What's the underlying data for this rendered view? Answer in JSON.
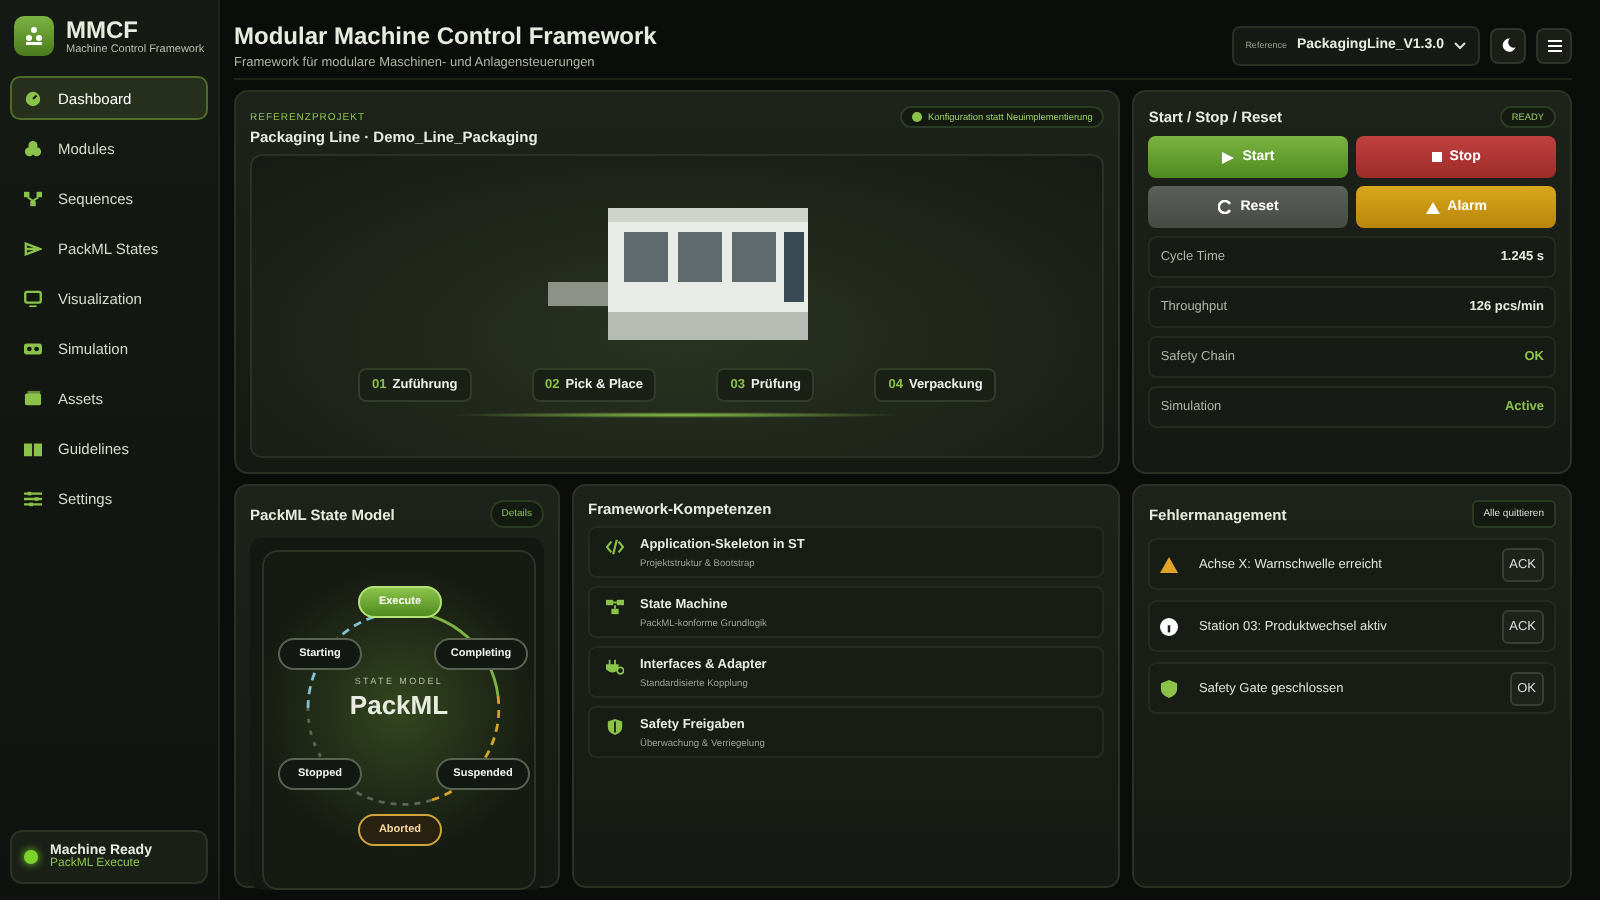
{
  "sidebar": {
    "logo": {
      "title": "MMCF",
      "subtitle": "Machine Control Framework"
    },
    "items": [
      {
        "label": "Dashboard",
        "selected": true
      },
      {
        "label": "Modules",
        "selected": false
      },
      {
        "label": "Sequences",
        "selected": false
      },
      {
        "label": "PackML States",
        "selected": false
      },
      {
        "label": "Visualization",
        "selected": false
      },
      {
        "label": "Simulation",
        "selected": false
      },
      {
        "label": "Assets",
        "selected": false
      },
      {
        "label": "Guidelines",
        "selected": false
      },
      {
        "label": "Settings",
        "selected": false
      }
    ],
    "status": {
      "title": "Machine Ready",
      "subtitle": "PackML Execute"
    }
  },
  "header": {
    "title": "Modular Machine Control Framework",
    "subtitle": "Framework für modulare Maschinen- und Anlagensteuerungen",
    "reference": {
      "label": "Reference",
      "value": "PackagingLine_V1.3.0"
    }
  },
  "project": {
    "eyebrow": "REFERENZPROJEKT",
    "title": "Packaging Line · Demo_Line_Packaging",
    "badge": "Konfiguration statt Neuimplementierung",
    "stations": [
      {
        "number": "01",
        "label": "Zuführung"
      },
      {
        "number": "02",
        "label": "Pick & Place"
      },
      {
        "number": "03",
        "label": "Prüfung"
      },
      {
        "number": "04",
        "label": "Verpackung"
      }
    ]
  },
  "control": {
    "title": "Start / Stop / Reset",
    "badge": "READY",
    "buttons": [
      {
        "kind": "start",
        "label": "Start"
      },
      {
        "kind": "stop",
        "label": "Stop"
      },
      {
        "kind": "reset",
        "label": "Reset"
      },
      {
        "kind": "alarm",
        "label": "Alarm"
      }
    ],
    "metrics": [
      {
        "label": "Cycle Time",
        "value": "1.245 s",
        "highlight": false
      },
      {
        "label": "Throughput",
        "value": "126 pcs/min",
        "highlight": false
      },
      {
        "label": "Safety Chain",
        "value": "OK",
        "highlight": true
      },
      {
        "label": "Simulation",
        "value": "Active",
        "highlight": true
      }
    ]
  },
  "state_model": {
    "title": "PackML State Model",
    "details": "Details",
    "eyebrow": "STATE MODEL",
    "name": "PackML",
    "states": [
      {
        "label": "Execute",
        "kind": "normal",
        "selected": true
      },
      {
        "label": "Starting",
        "kind": "normal",
        "selected": false
      },
      {
        "label": "Completing",
        "kind": "normal",
        "selected": false
      },
      {
        "label": "Stopped",
        "kind": "normal",
        "selected": false
      },
      {
        "label": "Suspended",
        "kind": "normal",
        "selected": false
      },
      {
        "label": "Aborted",
        "kind": "fault",
        "selected": false
      }
    ]
  },
  "competencies": {
    "title": "Framework-Kompetenzen",
    "items": [
      {
        "title": "Application-Skeleton in ST",
        "subtitle": "Projektstruktur & Bootstrap"
      },
      {
        "title": "State Machine",
        "subtitle": "PackML-konforme Grundlogik"
      },
      {
        "title": "Interfaces & Adapter",
        "subtitle": "Standardisierte Kopplung"
      },
      {
        "title": "Safety Freigaben",
        "subtitle": "Überwachung & Verriegelung"
      }
    ]
  },
  "faults": {
    "title": "Fehlermanagement",
    "action": "Alle quittieren",
    "items": [
      {
        "kind": "warning",
        "message": "Achse X: Warnschwelle erreicht",
        "action": "ACK"
      },
      {
        "kind": "info",
        "message": "Station 03: Produktwechsel aktiv",
        "action": "ACK"
      },
      {
        "kind": "safety",
        "message": "Safety Gate geschlossen",
        "action": "OK"
      }
    ]
  }
}
